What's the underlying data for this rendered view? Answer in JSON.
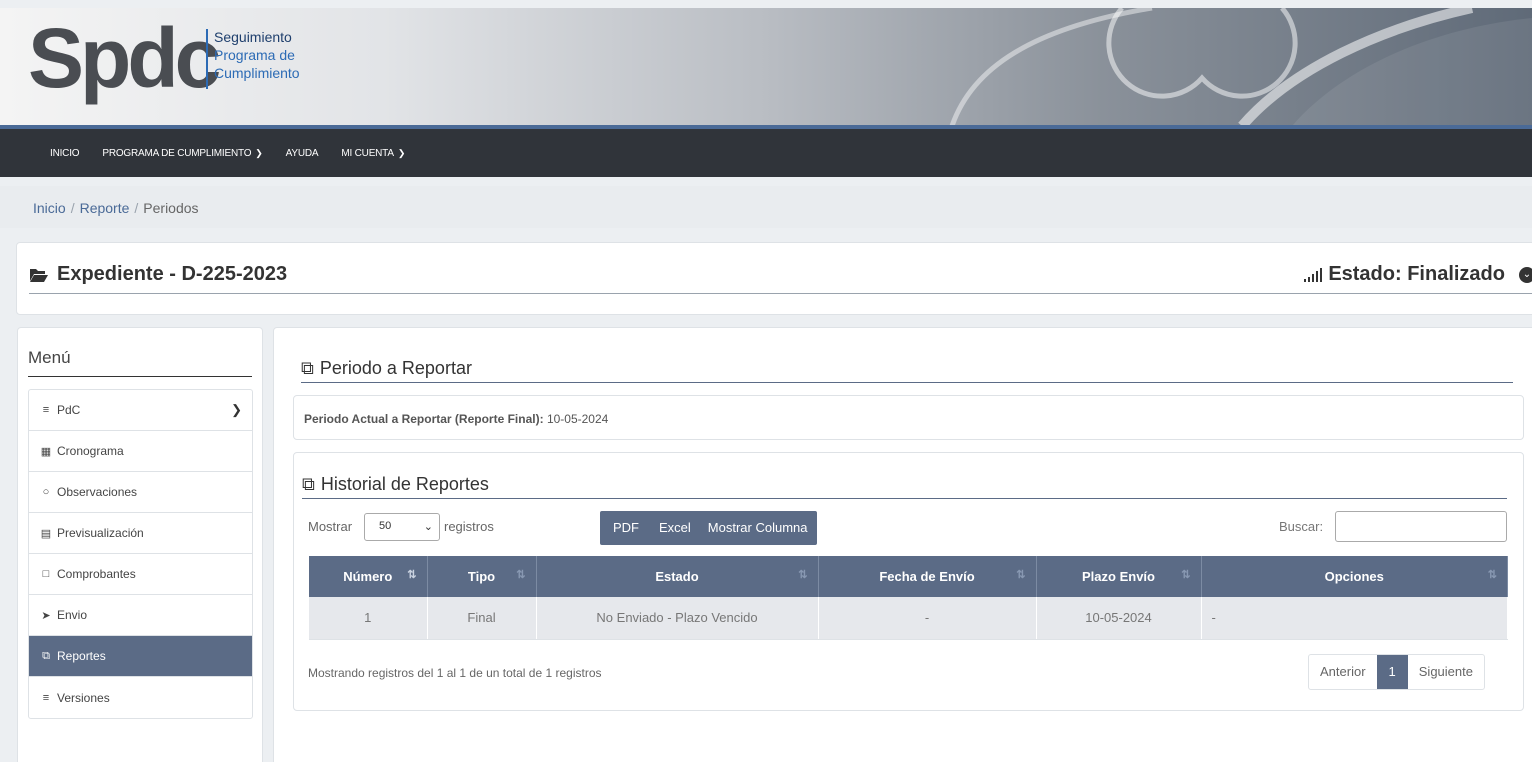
{
  "header": {
    "logo_word": "Spdc",
    "logo_line1": "Seguimiento",
    "logo_line2": "Programa de",
    "logo_line3": "Cumplimiento"
  },
  "nav": {
    "items": [
      {
        "label": "INICIO",
        "has_dropdown": false
      },
      {
        "label": "PROGRAMA DE CUMPLIMIENTO",
        "has_dropdown": true
      },
      {
        "label": "AYUDA",
        "has_dropdown": false
      },
      {
        "label": "MI CUENTA",
        "has_dropdown": true
      }
    ]
  },
  "breadcrumb": {
    "items": [
      "Inicio",
      "Reporte",
      "Periodos"
    ],
    "sep": "/"
  },
  "expediente": {
    "title": "Expediente - D-225-2023",
    "estado": "Estado: Finalizado"
  },
  "sidebar": {
    "title": "Menú",
    "items": [
      {
        "label": "PdC",
        "icon": "list-icon"
      },
      {
        "label": "Cronograma",
        "icon": "calendar-icon"
      },
      {
        "label": "Observaciones",
        "icon": "comment-icon"
      },
      {
        "label": "Previsualización",
        "icon": "preview-icon"
      },
      {
        "label": "Comprobantes",
        "icon": "receipt-icon"
      },
      {
        "label": "Envio",
        "icon": "send-icon"
      },
      {
        "label": "Reportes",
        "icon": "copy-icon"
      },
      {
        "label": "Versiones",
        "icon": "list-ol-icon"
      }
    ],
    "active_index": 6
  },
  "periodo": {
    "section_title": "Periodo a Reportar",
    "label": "Periodo Actual a Reportar (Reporte Final):",
    "value": "10-05-2024"
  },
  "historial": {
    "section_title": "Historial de Reportes",
    "show_label": "Mostrar",
    "show_value": "50",
    "records_label": "registros",
    "buttons": [
      "PDF",
      "Excel",
      "Mostrar Columna"
    ],
    "search_label": "Buscar:",
    "search_value": "",
    "columns": [
      "Número",
      "Tipo",
      "Estado",
      "Fecha de Envío",
      "Plazo Envío",
      "Opciones"
    ],
    "rows": [
      [
        "1",
        "Final",
        "No Enviado - Plazo Vencido",
        "-",
        "10-05-2024",
        "-"
      ]
    ],
    "info": "Mostrando registros del 1 al 1 de un total de 1 registros",
    "pager": {
      "prev": "Anterior",
      "current": "1",
      "next": "Siguiente"
    }
  },
  "colors": {
    "nav_bg": "#30343a",
    "accent": "#5b6b86",
    "link": "#4a6a97"
  }
}
